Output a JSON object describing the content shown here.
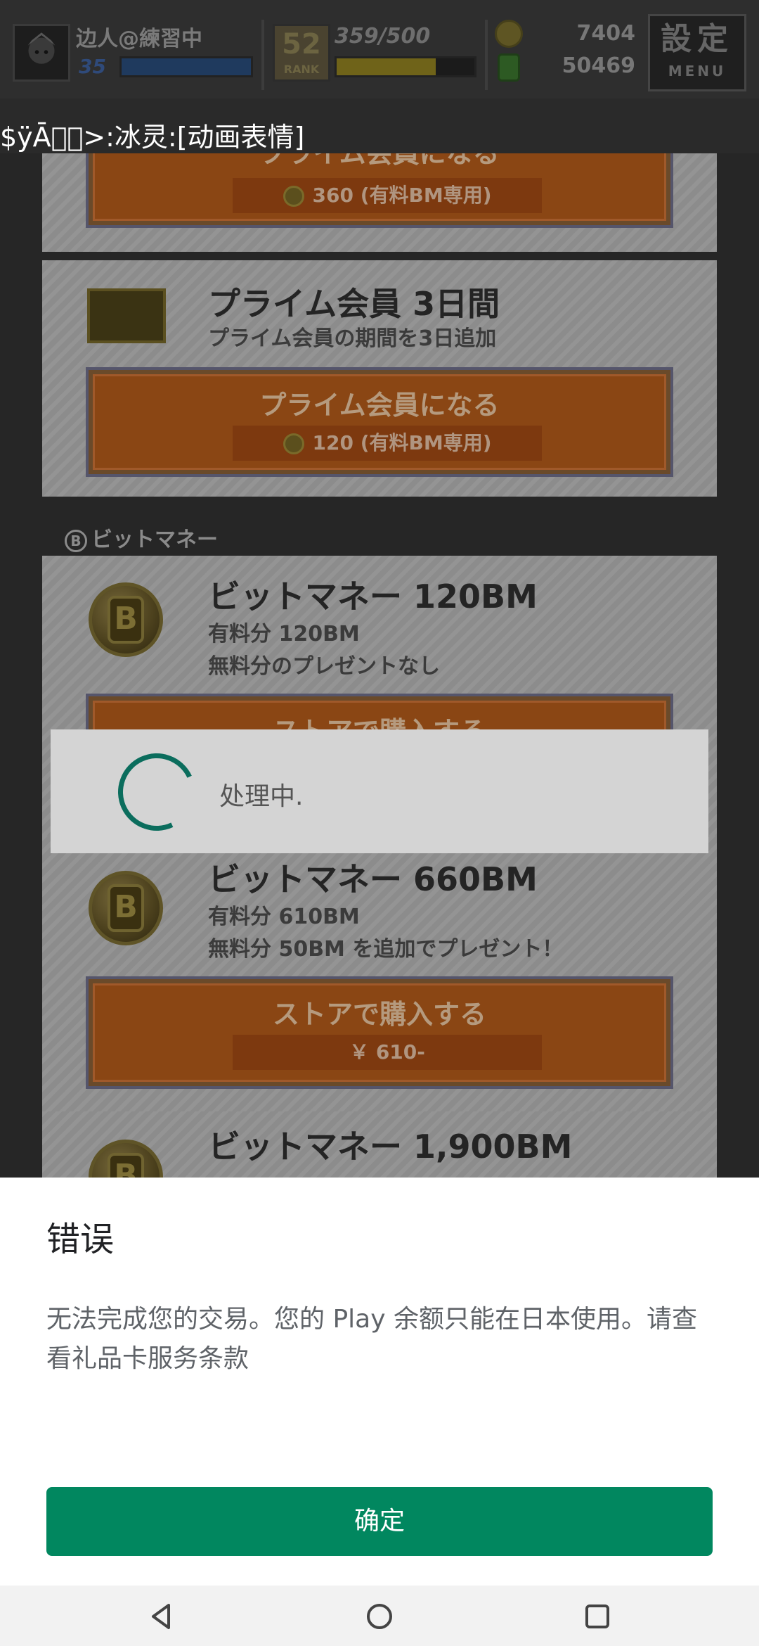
{
  "hud": {
    "player_name": "边人@練習中",
    "level": "35",
    "rank_number": "52",
    "rank_label": "RANK",
    "exp": "359/500",
    "exp_fraction": 0.718,
    "currency_bm": "7404",
    "currency_other": "50469",
    "menu_kanji": "設定",
    "menu_label": "MENU"
  },
  "debug_text": "$ÿĀ\u0000\u0000>:冰灵:[动画表情]",
  "shop": {
    "items": [
      {
        "title": "",
        "subtitle": "",
        "button_label": "プライム会員になる",
        "price": "360 (有料BM専用)"
      },
      {
        "title": "プライム会員 3日間",
        "subtitle": "プライム会員の期間を3日追加",
        "button_label": "プライム会員になる",
        "price": "120 (有料BM専用)"
      }
    ],
    "section_title": "ビットマネー",
    "bm_items": [
      {
        "title": "ビットマネー 120BM",
        "line1": "有料分 120BM",
        "line2": "無料分のプレゼントなし",
        "button_label": "ストアで購入する"
      },
      {
        "title": "ビットマネー 660BM",
        "line1": "有料分 610BM",
        "line2": "無料分 50BM を追加でプレゼント！",
        "button_label": "ストアで購入する",
        "price": "￥ 610-"
      },
      {
        "title": "ビットマネー 1,900BM"
      }
    ]
  },
  "processing": {
    "text": "处理中."
  },
  "error_dialog": {
    "title": "错误",
    "message": "无法完成您的交易。您的 Play 余额只能在日本使用。请查看礼品卡服务条款",
    "ok_label": "确定"
  },
  "colors": {
    "ok_button": "#01875f",
    "spinner": "#0b6d5d"
  }
}
